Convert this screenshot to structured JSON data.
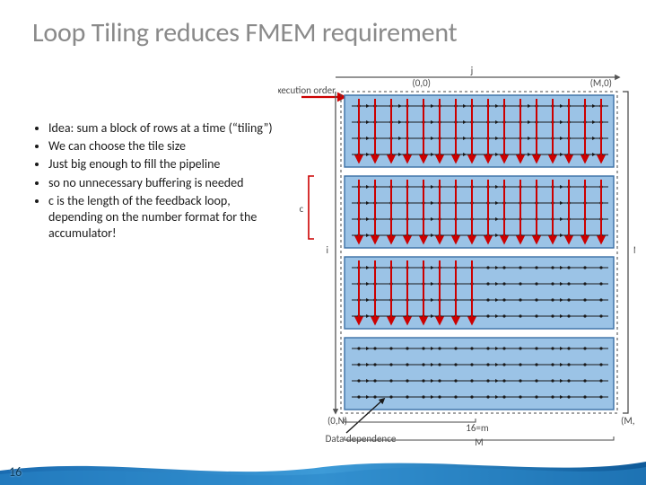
{
  "title": "Loop Tiling reduces FMEM requirement",
  "bullets": [
    "Idea: sum a block of rows at a time (“tiling”)",
    "We can choose the tile size",
    "Just big enough to fill the pipeline",
    "so no unnecessary buffering is needed",
    "c is the length of the feedback loop, depending on the number format for the accumulator!"
  ],
  "diagram": {
    "exec_order": "Execution order",
    "origin": "(0,0)",
    "m0": "(M,0)",
    "j": "j",
    "i": "i",
    "c": "c",
    "N": "N",
    "zeroN": "(0,N)",
    "sixteen_m": "16=m",
    "M": "M",
    "MN": "(M, N)",
    "data_dep": "Data dependence"
  },
  "slidenum": "16"
}
